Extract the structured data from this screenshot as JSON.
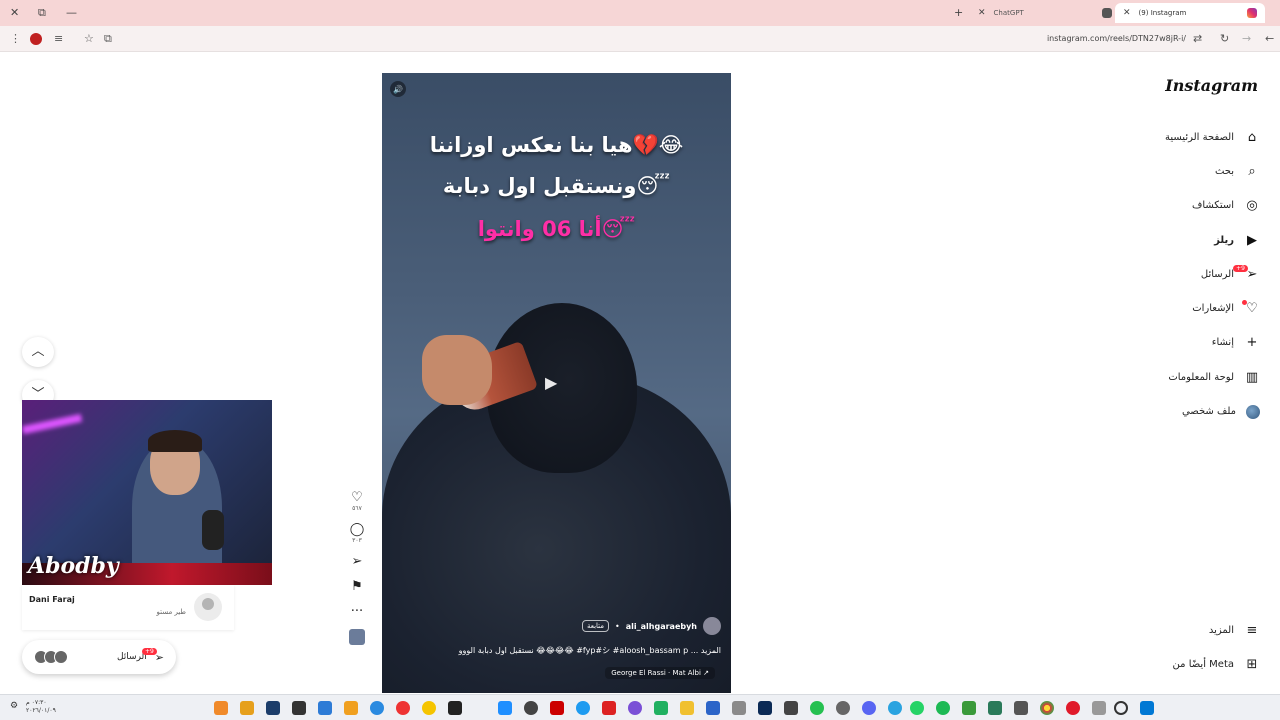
{
  "browser": {
    "tabs": [
      {
        "title": "ChatGPT",
        "active": false
      },
      {
        "title": "(9) Instagram",
        "active": true
      }
    ],
    "url": "instagram.com/reels/DTN27w8jR-i/"
  },
  "instagram": {
    "logo": "Instagram",
    "nav": [
      {
        "label": "الصفحة الرئيسية",
        "icon": "home-icon"
      },
      {
        "label": "بحث",
        "icon": "search-icon"
      },
      {
        "label": "استكشاف",
        "icon": "explore-icon"
      },
      {
        "label": "ريلز",
        "icon": "reels-icon"
      },
      {
        "label": "الرسائل",
        "icon": "messages-icon",
        "badge": "+9"
      },
      {
        "label": "الإشعارات",
        "icon": "heart-icon"
      },
      {
        "label": "إنشاء",
        "icon": "plus-icon"
      },
      {
        "label": "لوحة المعلومات",
        "icon": "dashboard-icon"
      },
      {
        "label": "ملف شخصي",
        "icon": "profile-avatar"
      }
    ],
    "more": "المزيد",
    "also_from_meta": "أيضًا من Meta"
  },
  "reel": {
    "caption_line1": "هيا بنا نعكس اوزاننا💔😂",
    "caption_line2": "ونستقبل اول دبابة😴",
    "caption_line3": "أنا 06 وانتوا😴",
    "author": "ali_alhgaraebyh",
    "follow": "متابعة",
    "description": "نستقبل اول دبابة الووو 😂😂😂😂 #fyp#シ #aloosh_bassam p ... المزيد",
    "music": "George El Rassi · Mat Albi ↗"
  },
  "actions": {
    "likes": "٥٦٧",
    "comments": "٣٠٣"
  },
  "overlay": {
    "streamer_tag": "Abodby",
    "suggested_name": "Dani Faraj",
    "suggested_subtitle": "طير مستو",
    "messages_label": "الرسائل",
    "messages_badge": "+9"
  },
  "taskbar": {
    "time": "٠٧:٣٠ م",
    "date": "٢٠٢٦/٠١/٠٩"
  },
  "colors": {
    "badge": "#ff3040",
    "tabbar": "#f6d6d6",
    "reel_pink_text": "#ff2ea6"
  }
}
